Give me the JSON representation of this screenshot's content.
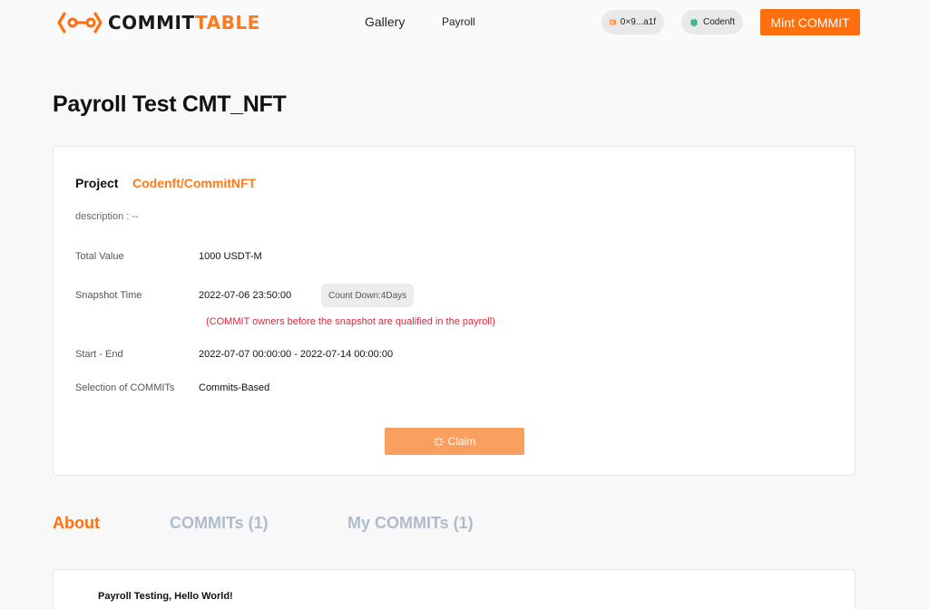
{
  "brand": {
    "logo_main": "COMMIT",
    "logo_accent": "TABLE",
    "accent_color": "#ff6f0f"
  },
  "nav": {
    "gallery": "Gallery",
    "payroll": "Payroll"
  },
  "header": {
    "wallet": "0×9...a1f",
    "user": "Codenft",
    "mint_button": "Mint COMMIT"
  },
  "page": {
    "title": "Payroll Test CMT_NFT"
  },
  "details": {
    "project_label": "Project",
    "project_value": "Codenft/CommitNFT",
    "description": "description : --",
    "total_value_label": "Total Value",
    "total_value": "1000 USDT-M",
    "snapshot_label": "Snapshot Time",
    "snapshot_value": "2022-07-06 23:50:00",
    "countdown": "Count Down:4Days",
    "qualification_note": "(COMMIT owners before the snapshot are qualified in the payroll)",
    "start_end_label": "Start - End",
    "start_end_value": "2022-07-07 00:00:00 - 2022-07-14 00:00:00",
    "selection_label": "Selection of COMMITs",
    "selection_value": "Commits-Based",
    "claim_button": "Claim"
  },
  "tabs": {
    "about": "About",
    "commits": "COMMITs (1)",
    "my_commits": "My COMMITs (1)"
  },
  "about": {
    "text": "Payroll Testing, Hello World!"
  }
}
